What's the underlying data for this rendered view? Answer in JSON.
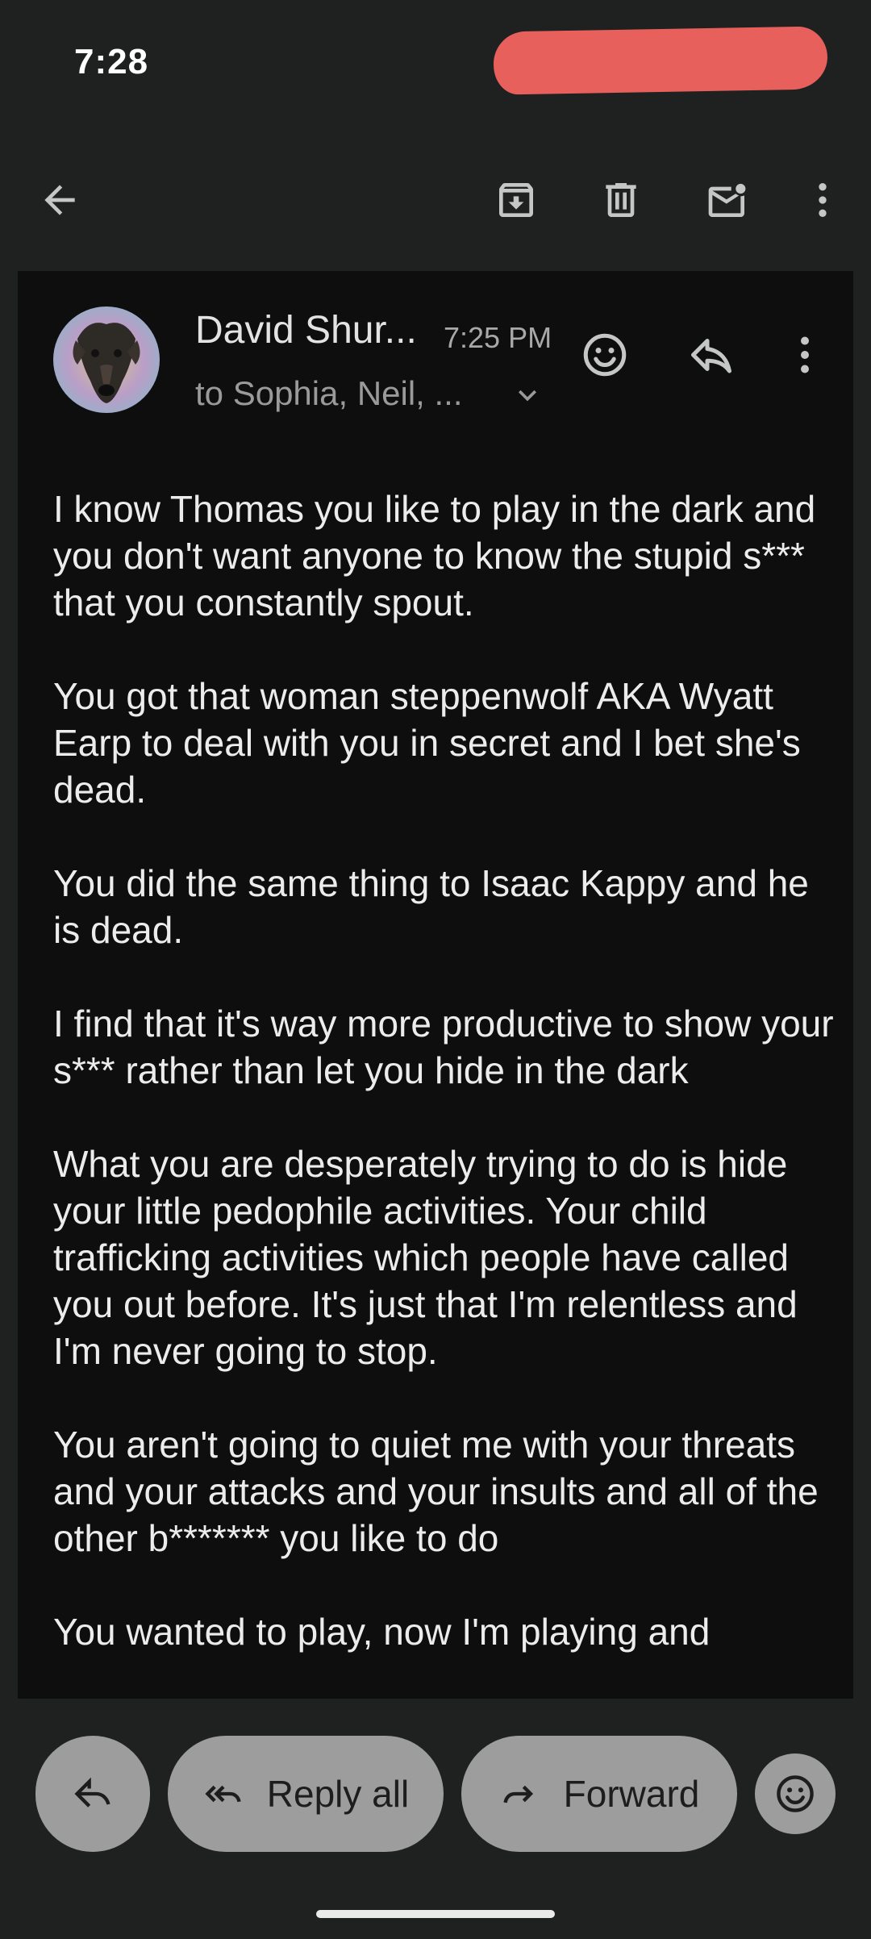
{
  "status_bar": {
    "time": "7:28"
  },
  "toolbar": {
    "back_icon": "arrow-back-icon",
    "archive_icon": "archive-icon",
    "delete_icon": "trash-icon",
    "mark_unread_icon": "mail-unread-icon",
    "more_icon": "more-vert-icon"
  },
  "email": {
    "sender": "David Shur...",
    "time": "7:25 PM",
    "recipients": "to Sophia, Neil, ...",
    "body": [
      "I know Thomas you like to play in the dark and you don't want anyone to know the stupid s*** that you constantly spout.",
      "You got that woman steppenwolf AKA Wyatt Earp to deal with you in secret and I bet she's dead.",
      "You did the same thing to Isaac Kappy and he is dead.",
      "I find that it's way more productive to show your s*** rather than let you hide in the dark",
      "What you are desperately trying to do is hide your little pedophile activities. Your child trafficking activities which people have called you out before. It's just that I'm relentless and I'm never going to stop.",
      "You aren't going to quiet me with your threats and your attacks and your insults and all of the other b******* you like to do",
      "You wanted to play, now I'm playing and"
    ]
  },
  "actions": {
    "reply_all": "Reply all",
    "forward": "Forward"
  },
  "colors": {
    "background": "#1f2020",
    "card": "#0e0e0e",
    "pill": "#9d9d9d",
    "redaction": "#e8605b"
  }
}
